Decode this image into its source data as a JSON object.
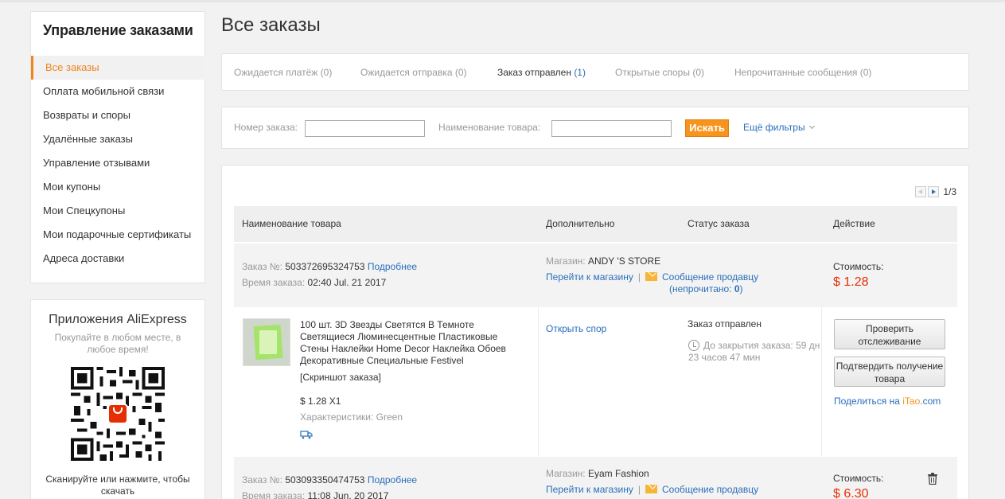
{
  "sidebar": {
    "title": "Управление заказами",
    "items": [
      {
        "label": "Все заказы",
        "active": true
      },
      {
        "label": "Оплата мобильной связи"
      },
      {
        "label": "Возвраты и споры"
      },
      {
        "label": "Удалённые заказы"
      },
      {
        "label": "Управление отзывами"
      },
      {
        "label": "Мои купоны"
      },
      {
        "label": "Мои Спецкупоны"
      },
      {
        "label": "Мои подарочные сертификаты"
      },
      {
        "label": "Адреса доставки"
      }
    ]
  },
  "apps": {
    "title": "Приложения AliExpress",
    "subtitle": "Покупайте в любом месте, в любое время!",
    "bottom_text": "Сканируйте или нажмите, чтобы скачать"
  },
  "page_title": "Все заказы",
  "status_tabs": [
    {
      "label": "Ожидается платёж",
      "count": "(0)"
    },
    {
      "label": "Ожидается отправка",
      "count": "(0)"
    },
    {
      "label": "Заказ отправлен",
      "count": "(1)",
      "active": true
    },
    {
      "label": "Открытые споры",
      "count": "(0)"
    },
    {
      "label": "Непрочитанные сообщения",
      "count": "(0)"
    }
  ],
  "filters": {
    "order_number_label": "Номер заказа:",
    "product_name_label": "Наименование товара:",
    "order_number_value": "",
    "product_name_value": "",
    "search_button": "Искать",
    "more_filters": "Ещё фильтры"
  },
  "pager": {
    "page": "1/3"
  },
  "table_headers": {
    "product": "Наименование товара",
    "extra": "Дополнительно",
    "status": "Статус заказа",
    "action": "Действие"
  },
  "orders": [
    {
      "number_label": "Заказ №:",
      "number": "503372695324753",
      "details_link": "Подробнее",
      "time_label": "Время заказа:",
      "time": "02:40 Jul. 21 2017",
      "store_label": "Магазин:",
      "store": "ANDY 'S STORE",
      "go_to_store": "Перейти к магазину",
      "message_seller": "Сообщение продавцу",
      "unread_label": "(непрочитано:",
      "unread_count": "0",
      "unread_close": ")",
      "cost_label": "Стоимость:",
      "cost": "$ 1.28",
      "product": {
        "title": "100 шт. 3D Звезды Светятся В Темноте Светящиеся Люминесцентные Пластиковые Стены Наклейки Home Decor Наклейка Обоев Декоративные Специальные Festivel",
        "snapshot": "[Скриншот заказа]",
        "price_qty": "$ 1.28 X1",
        "specs_label": "Характеристики:",
        "specs": "Green"
      },
      "open_dispute": "Открыть спор",
      "status": "Заказ отправлен",
      "countdown": "До закрытия заказа: 59 дн 23 часов 47 мин",
      "btn_track": "Проверить отслеживание",
      "btn_confirm": "Подтвердить получение товара",
      "share_prefix": "Поделиться на ",
      "share_itao": "iTao",
      "share_suffix": ".com"
    },
    {
      "number_label": "Заказ №:",
      "number": "503093350474753",
      "details_link": "Подробнее",
      "time_label": "Время заказа:",
      "time": "11:08 Jun. 20 2017",
      "store_label": "Магазин:",
      "store": "Eyam Fashion",
      "go_to_store": "Перейти к магазину",
      "message_seller": "Сообщение продавцу",
      "cost_label": "Стоимость:",
      "cost": "$ 6.30"
    }
  ],
  "colors": {
    "accent": "#f0841e",
    "link": "#2a6ebb",
    "price": "#e62e04",
    "search_button": "#f7941d"
  }
}
